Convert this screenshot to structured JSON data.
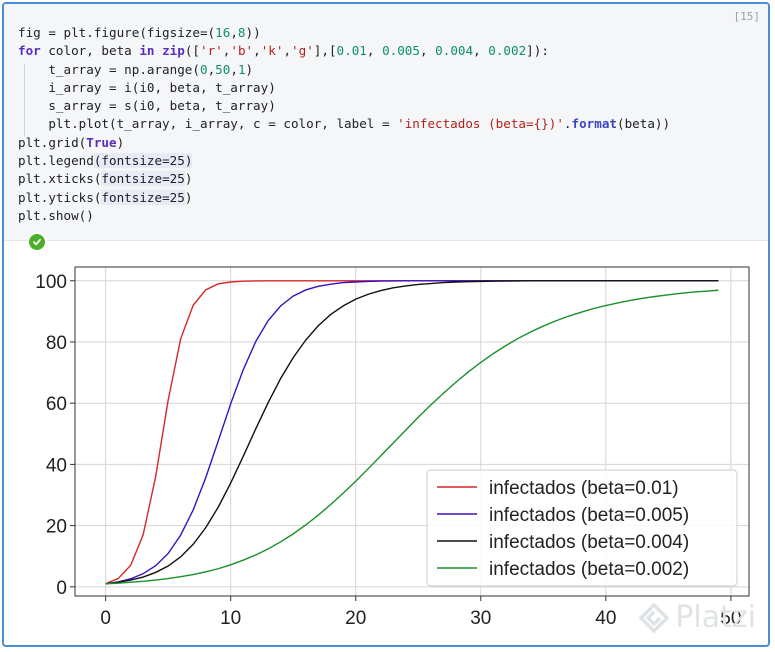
{
  "cell": {
    "execution_count": "[15]",
    "code_lines": [
      [
        {
          "t": "fig = plt.figure(figsize=("
        },
        {
          "t": "16",
          "c": "num"
        },
        {
          "t": ","
        },
        {
          "t": "8",
          "c": "num"
        },
        {
          "t": "))"
        }
      ],
      [
        {
          "t": "for",
          "c": "kw"
        },
        {
          "t": " color, beta "
        },
        {
          "t": "in",
          "c": "kw"
        },
        {
          "t": " "
        },
        {
          "t": "zip",
          "c": "kw"
        },
        {
          "t": "(["
        },
        {
          "t": "'r'",
          "c": "str"
        },
        {
          "t": ","
        },
        {
          "t": "'b'",
          "c": "str"
        },
        {
          "t": ","
        },
        {
          "t": "'k'",
          "c": "str"
        },
        {
          "t": ","
        },
        {
          "t": "'g'",
          "c": "str"
        },
        {
          "t": "],["
        },
        {
          "t": "0.01",
          "c": "num"
        },
        {
          "t": ", "
        },
        {
          "t": "0.005",
          "c": "num"
        },
        {
          "t": ", "
        },
        {
          "t": "0.004",
          "c": "num"
        },
        {
          "t": ", "
        },
        {
          "t": "0.002",
          "c": "num"
        },
        {
          "t": "]):"
        }
      ],
      [
        {
          "t": "    t_array = np.arange("
        },
        {
          "t": "0",
          "c": "num"
        },
        {
          "t": ","
        },
        {
          "t": "50",
          "c": "num"
        },
        {
          "t": ","
        },
        {
          "t": "1",
          "c": "num"
        },
        {
          "t": ")"
        }
      ],
      [
        {
          "t": "    i_array = i(i0, beta, t_array)"
        }
      ],
      [
        {
          "t": "    s_array = s(i0, beta, t_array)"
        }
      ],
      [
        {
          "t": "    plt.plot(t_array, i_array, c = color, label = "
        },
        {
          "t": "'infectados (beta={})'",
          "c": "str"
        },
        {
          "t": "."
        },
        {
          "t": "format",
          "c": "fmt"
        },
        {
          "t": "(beta))"
        }
      ],
      [
        {
          "t": "plt.grid("
        },
        {
          "t": "True",
          "c": "tr"
        },
        {
          "t": ")"
        }
      ],
      [
        {
          "t": "plt.legend"
        },
        {
          "t": "(fontsize=25)",
          "c": "hl"
        }
      ],
      [
        {
          "t": "plt.xticks("
        },
        {
          "t": "fontsize=25",
          "c": "hl"
        },
        {
          "t": ")"
        }
      ],
      [
        {
          "t": "plt.yticks("
        },
        {
          "t": "fontsize=25",
          "c": "hl"
        },
        {
          "t": ")"
        }
      ],
      [
        {
          "t": "plt.show()"
        }
      ]
    ]
  },
  "icons": {
    "status": "check-circle-icon",
    "watermark": "platzi-logo-icon"
  },
  "watermark_text": "Platzi",
  "colors": {
    "frame_border": "#4a8fd6",
    "status_ok": "#4caf2a"
  },
  "chart_data": {
    "type": "line",
    "title": "",
    "xlabel": "",
    "ylabel": "",
    "xlim": [
      -2.45,
      51.45
    ],
    "ylim": [
      -3,
      104.5
    ],
    "xticks": [
      0,
      10,
      20,
      30,
      40,
      50
    ],
    "yticks": [
      0,
      20,
      40,
      60,
      80,
      100
    ],
    "grid": true,
    "legend_position": "lower-right",
    "x": [
      0,
      1,
      2,
      3,
      4,
      5,
      6,
      7,
      8,
      9,
      10,
      11,
      12,
      13,
      14,
      15,
      16,
      17,
      18,
      19,
      20,
      21,
      22,
      23,
      24,
      25,
      26,
      27,
      28,
      29,
      30,
      31,
      32,
      33,
      34,
      35,
      36,
      37,
      38,
      39,
      40,
      41,
      42,
      43,
      44,
      45,
      46,
      47,
      48,
      49
    ],
    "series": [
      {
        "name": "infectados (beta=0.01)",
        "color": "#d62728",
        "values": [
          1.0,
          2.7,
          7.0,
          17.0,
          36.0,
          61.0,
          81.0,
          92.0,
          97.0,
          99.0,
          99.6,
          99.85,
          99.95,
          100,
          100,
          100,
          100,
          100,
          100,
          100,
          100,
          100,
          100,
          100,
          100,
          100,
          100,
          100,
          100,
          100,
          100,
          100,
          100,
          100,
          100,
          100,
          100,
          100,
          100,
          100,
          100,
          100,
          100,
          100,
          100,
          100,
          100,
          100,
          100,
          100
        ]
      },
      {
        "name": "infectados (beta=0.005)",
        "color": "#3b0fc2",
        "values": [
          1.0,
          1.6,
          2.6,
          4.3,
          6.9,
          10.9,
          16.9,
          25.1,
          35.6,
          47.6,
          59.8,
          70.9,
          80.1,
          87.0,
          91.8,
          95.0,
          97.0,
          98.2,
          98.9,
          99.4,
          99.6,
          99.8,
          99.9,
          99.95,
          100,
          100,
          100,
          100,
          100,
          100,
          100,
          100,
          100,
          100,
          100,
          100,
          100,
          100,
          100,
          100,
          100,
          100,
          100,
          100,
          100,
          100,
          100,
          100,
          100,
          100
        ]
      },
      {
        "name": "infectados (beta=0.004)",
        "color": "#111111",
        "values": [
          1.0,
          1.5,
          2.2,
          3.2,
          4.7,
          6.8,
          9.8,
          13.9,
          19.3,
          26.0,
          33.9,
          42.6,
          51.6,
          60.2,
          68.1,
          74.9,
          80.6,
          85.3,
          89.0,
          91.8,
          94.0,
          95.6,
          96.8,
          97.7,
          98.3,
          98.8,
          99.1,
          99.4,
          99.6,
          99.7,
          99.8,
          99.85,
          99.9,
          99.95,
          100,
          100,
          100,
          100,
          100,
          100,
          100,
          100,
          100,
          100,
          100,
          100,
          100,
          100,
          100,
          100
        ]
      },
      {
        "name": "infectados (beta=0.002)",
        "color": "#1a8f2a",
        "values": [
          1.0,
          1.2,
          1.5,
          1.8,
          2.2,
          2.7,
          3.3,
          4.0,
          4.9,
          5.9,
          7.2,
          8.7,
          10.4,
          12.4,
          14.7,
          17.3,
          20.2,
          23.4,
          26.9,
          30.6,
          34.5,
          38.6,
          42.8,
          47.0,
          51.2,
          55.4,
          59.4,
          63.2,
          66.8,
          70.2,
          73.3,
          76.2,
          78.8,
          81.2,
          83.3,
          85.2,
          86.9,
          88.4,
          89.7,
          90.9,
          91.9,
          92.8,
          93.6,
          94.3,
          94.9,
          95.4,
          95.9,
          96.3,
          96.6,
          96.9
        ]
      }
    ]
  }
}
